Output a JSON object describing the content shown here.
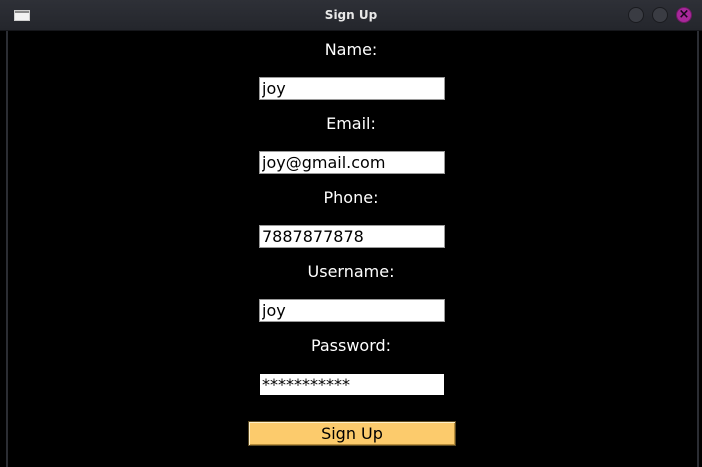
{
  "window": {
    "title": "Sign Up",
    "icon": "window-app-icon",
    "controls": [
      "minimize-icon",
      "maximize-icon",
      "close-icon"
    ],
    "close_glyph": "×"
  },
  "form": {
    "name": {
      "label": "Name:",
      "value": "joy"
    },
    "email": {
      "label": "Email:",
      "value": "joy@gmail.com"
    },
    "phone": {
      "label": "Phone:",
      "value": "7887877878"
    },
    "username": {
      "label": "Username:",
      "value": "joy"
    },
    "password": {
      "label": "Password:",
      "value": "***********"
    },
    "submit_label": "Sign Up"
  },
  "colors": {
    "background": "#000000",
    "label_text": "#ffffff",
    "button_bg": "#fccb6c",
    "close_button": "#a8289a"
  }
}
